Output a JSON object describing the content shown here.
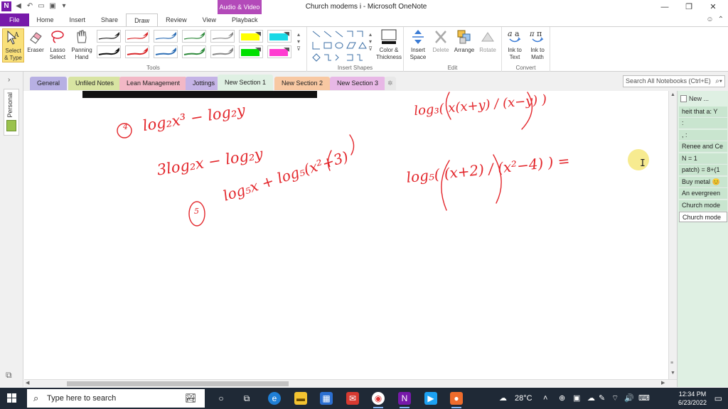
{
  "window": {
    "title": "Church modems i  -  Microsoft OneNote",
    "context_tab_title": "Audio & Video",
    "app_icon": "N",
    "controls": [
      "—",
      "❐",
      "✕"
    ]
  },
  "ribbon": {
    "tabs": [
      "File",
      "Home",
      "Insert",
      "Share",
      "Draw",
      "Review",
      "View",
      "Playback"
    ],
    "active_tab": "Draw",
    "tools": {
      "label": "Tools",
      "select_type": "Select & Type",
      "eraser": "Eraser",
      "lasso": "Lasso Select",
      "panning": "Panning Hand"
    },
    "pens": [
      {
        "color": "#222222",
        "highlight": false
      },
      {
        "color": "#d8282b",
        "highlight": false
      },
      {
        "color": "#2f6fb5",
        "highlight": false
      },
      {
        "color": "#2f8a3c",
        "highlight": false
      },
      {
        "color": "#888888",
        "highlight": false
      },
      {
        "color": "#ffff00",
        "highlight": true
      },
      {
        "color": "#19d9e6",
        "highlight": true
      },
      {
        "color": "#111111",
        "highlight": false
      },
      {
        "color": "#d8282b",
        "highlight": false
      },
      {
        "color": "#2f6fb5",
        "highlight": false
      },
      {
        "color": "#2f8a3c",
        "highlight": false
      },
      {
        "color": "#888888",
        "highlight": false
      },
      {
        "color": "#00e000",
        "highlight": true
      },
      {
        "color": "#ff3cd1",
        "highlight": true
      }
    ],
    "insert_shapes": {
      "label": "Insert Shapes",
      "color_thickness": "Color & Thickness"
    },
    "edit": {
      "label": "Edit",
      "insert_space": "Insert Space",
      "delete": "Delete",
      "arrange": "Arrange",
      "rotate": "Rotate"
    },
    "convert": {
      "label": "Convert",
      "ink_to_text": "Ink to Text",
      "ink_to_math": "Ink to Math"
    }
  },
  "sections": [
    {
      "label": "General",
      "color": "#b7b0e3"
    },
    {
      "label": "Unfiled Notes",
      "color": "#d8e4a2"
    },
    {
      "label": "Lean Management",
      "color": "#f2b8c6"
    },
    {
      "label": "Jottings",
      "color": "#c4b3e6"
    },
    {
      "label": "New Section 1",
      "color": "#dff0e3",
      "active": true
    },
    {
      "label": "New Section 2",
      "color": "#f8c8a2"
    },
    {
      "label": "New Section 3",
      "color": "#e8b8e6"
    }
  ],
  "search": {
    "placeholder": "Search All Notebooks (Ctrl+E)"
  },
  "notebook": {
    "label": "Personal"
  },
  "pages": {
    "new_page": "New ...",
    "items": [
      "heit that a: Y",
      ":",
      ", :",
      "Renee and Ce",
      "N = 1",
      "patch) = 8+(1",
      "Buy metal 😊",
      "An evergreen",
      "Church mode",
      "Church mode"
    ],
    "selected_index": 9
  },
  "ink": {
    "problem4_number": "4",
    "problem4_expr": "log₂x³ − log₂y",
    "problem4_step": "3log₂x − log₂y",
    "problem5_number": "5",
    "problem5_expr": "log₅x + log₅(x²+3)",
    "right_top_expr": "log₃( x(x+y) / (x−y) )",
    "right_expr": "log₅( (x+2) / (x²−4) ) ="
  },
  "taskbar": {
    "search_placeholder": "Type here to search",
    "weather": "28°C",
    "time": "12:34 PM",
    "date": "6/23/2022"
  }
}
